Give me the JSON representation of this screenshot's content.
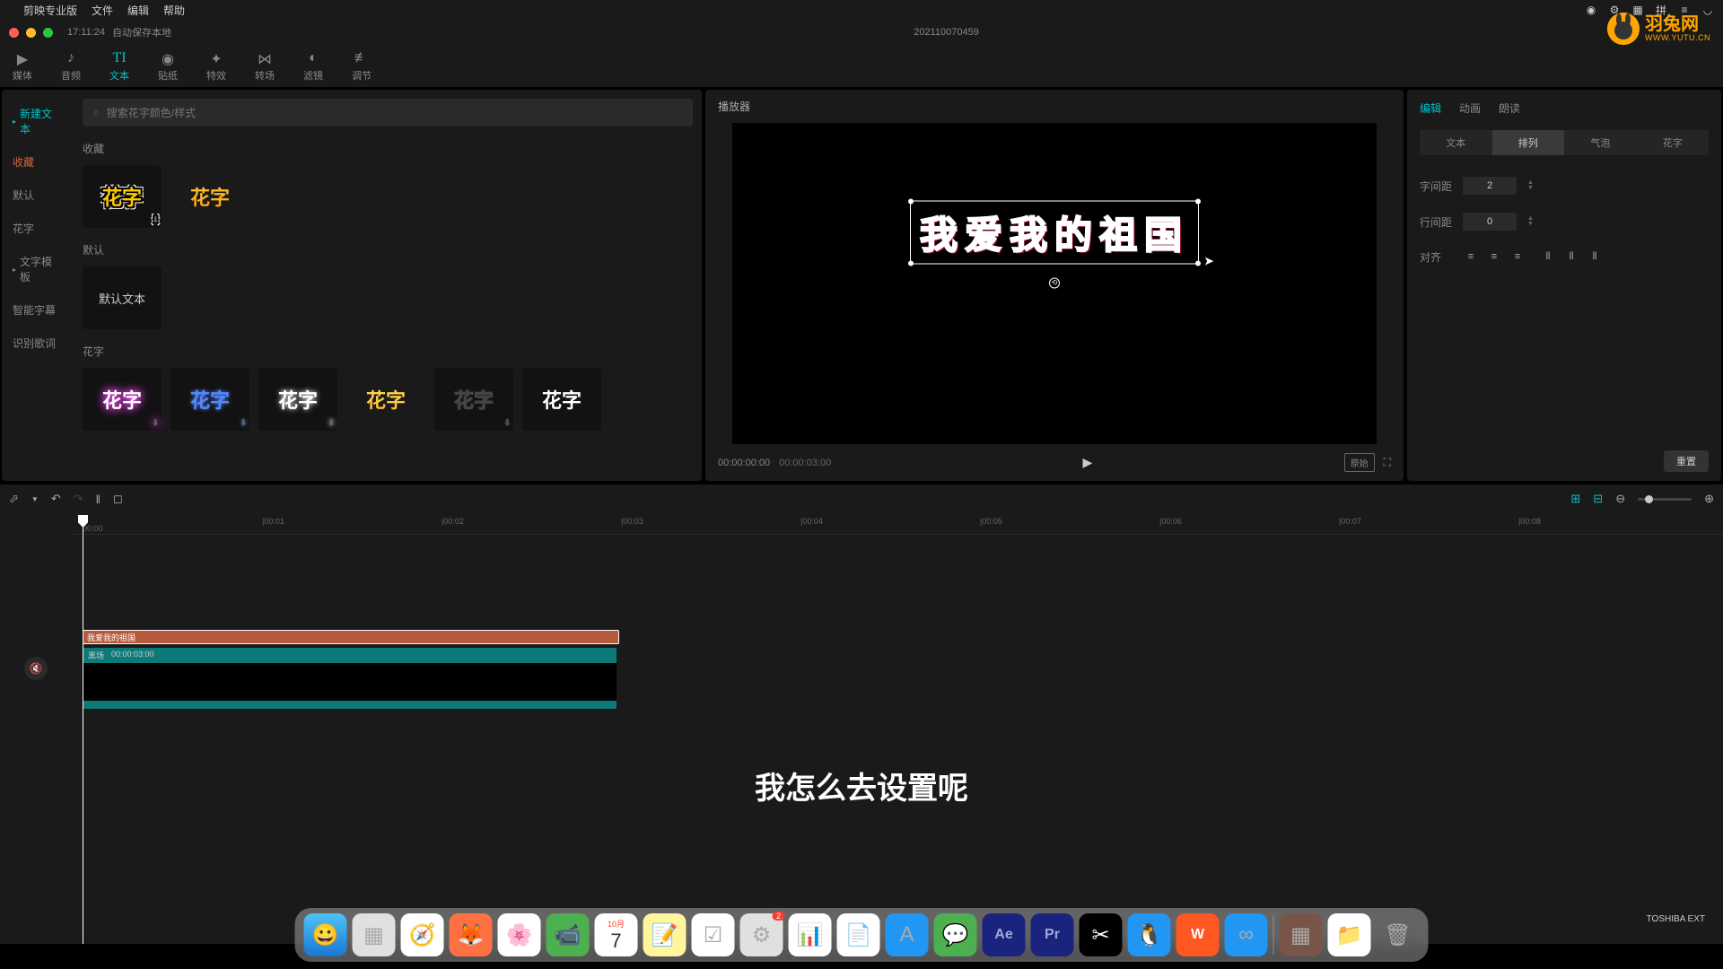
{
  "menubar": {
    "app": "剪映专业版",
    "items": [
      "文件",
      "编辑",
      "帮助"
    ]
  },
  "window": {
    "time": "17:11:24",
    "autosave": "自动保存本地",
    "project_name": "202110070459"
  },
  "top_tabs": [
    {
      "icon": "▶",
      "label": "媒体"
    },
    {
      "icon": "♪",
      "label": "音频"
    },
    {
      "icon": "TI",
      "label": "文本"
    },
    {
      "icon": "◉",
      "label": "贴纸"
    },
    {
      "icon": "✦",
      "label": "特效"
    },
    {
      "icon": "⋈",
      "label": "转场"
    },
    {
      "icon": "◐",
      "label": "滤镜"
    },
    {
      "icon": "≡",
      "label": "调节"
    }
  ],
  "left_nav": [
    {
      "label": "新建文本",
      "arrow": true
    },
    {
      "label": "收藏"
    },
    {
      "label": "默认"
    },
    {
      "label": "花字"
    },
    {
      "label": "文字模板",
      "arrow": true
    },
    {
      "label": "智能字幕"
    },
    {
      "label": "识别歌词"
    }
  ],
  "search": {
    "placeholder": "搜索花字颜色/样式"
  },
  "sections": {
    "favorites": "收藏",
    "default": "默认",
    "default_text": "默认文本",
    "huazi": "花字",
    "huazi_label": "花字"
  },
  "preview": {
    "title": "播放器",
    "text_content": "我爱我的祖国",
    "time_current": "00:00:00:00",
    "time_total": "00:00:03:00",
    "original": "原始"
  },
  "right_panel": {
    "tabs": [
      "编辑",
      "动画",
      "朗读"
    ],
    "sub_tabs": [
      "文本",
      "排列",
      "气泡",
      "花字"
    ],
    "letter_spacing": {
      "label": "字间距",
      "value": "2"
    },
    "line_spacing": {
      "label": "行间距",
      "value": "0"
    },
    "align": {
      "label": "对齐"
    },
    "reset": "重置"
  },
  "timeline": {
    "marks": [
      "00:00",
      "00:01",
      "00:02",
      "00:03",
      "00:04",
      "00:05",
      "00:06",
      "00:07",
      "00:08"
    ],
    "text_clip": "我爱我的祖国",
    "video_label": "黑场",
    "video_time": "00:00:03:00"
  },
  "subtitle": "我怎么去设置呢",
  "logo": {
    "name": "羽兔网",
    "url": "WWW.YUTU.CN"
  },
  "dock": {
    "calendar_month": "10月",
    "calendar_day": "7",
    "badge": "2"
  },
  "desktop_drive": "TOSHIBA EXT"
}
